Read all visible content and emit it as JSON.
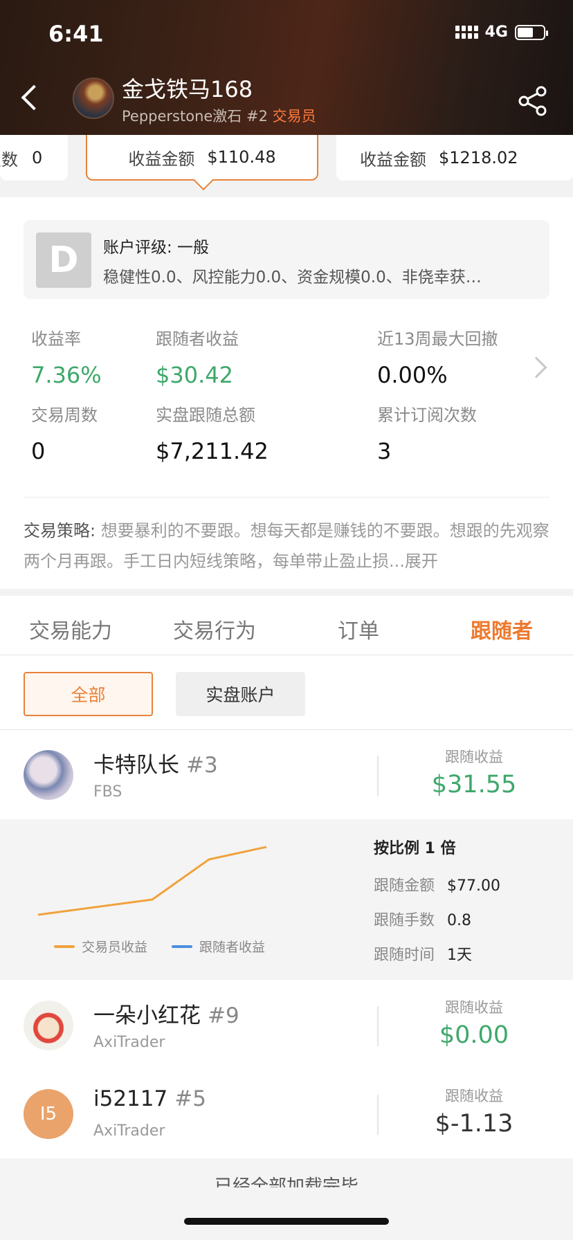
{
  "status": {
    "time": "6:41",
    "network": "4G"
  },
  "header": {
    "name": "金戈铁马168",
    "broker": "Pepperstone激石",
    "rank": "#2",
    "role": "交易员"
  },
  "cards": [
    {
      "label": "点数",
      "value": "0"
    },
    {
      "label": "收益金额",
      "value": "$110.48"
    },
    {
      "label": "收益金额",
      "value": "$1218.02"
    }
  ],
  "rating": {
    "grade": "D",
    "title": "账户评级: 一般",
    "desc": "稳健性0.0、风控能力0.0、资金规模0.0、非侥幸获…"
  },
  "stats": {
    "return_rate": {
      "label": "收益率",
      "value": "7.36%"
    },
    "follower_profit": {
      "label": "跟随者收益",
      "value": "$30.42"
    },
    "max_drawdown": {
      "label": "近13周最大回撤",
      "value": "0.00%"
    },
    "trade_weeks": {
      "label": "交易周数",
      "value": "0"
    },
    "follow_total": {
      "label": "实盘跟随总额",
      "value": "$7,211.42"
    },
    "subscriptions": {
      "label": "累计订阅次数",
      "value": "3"
    }
  },
  "strategy": {
    "label": "交易策略:",
    "text": " 想要暴利的不要跟。想每天都是赚钱的不要跟。想跟的先观察两个月再跟。手工日内短线策略，每单带止盈止损...",
    "more": "展开"
  },
  "tabs": [
    "交易能力",
    "交易行为",
    "订单",
    "跟随者"
  ],
  "filters": {
    "all": "全部",
    "live": "实盘账户"
  },
  "followers": [
    {
      "name": "卡特队长",
      "rank": "#3",
      "broker": "FBS",
      "profit_label": "跟随收益",
      "profit": "$31.55"
    },
    {
      "name": "一朵小红花",
      "rank": "#9",
      "broker": "AxiTrader",
      "profit_label": "跟随收益",
      "profit": "$0.00"
    },
    {
      "name": "i52117",
      "rank": "#5",
      "broker": "AxiTrader",
      "profit_label": "跟随收益",
      "profit": "$-1.13",
      "initials": "I5"
    }
  ],
  "detail": {
    "title": "按比例 1 倍",
    "amount_label": "跟随金额",
    "amount": "$77.00",
    "lots_label": "跟随手数",
    "lots": "0.8",
    "time_label": "跟随时间",
    "time": "1天",
    "legend_trader": "交易员收益",
    "legend_follower": "跟随者收益",
    "colors": {
      "trader": "#f0a23c",
      "follower": "#4a8fe0"
    }
  },
  "footer": {
    "loaded": "已经全部加载完毕"
  }
}
